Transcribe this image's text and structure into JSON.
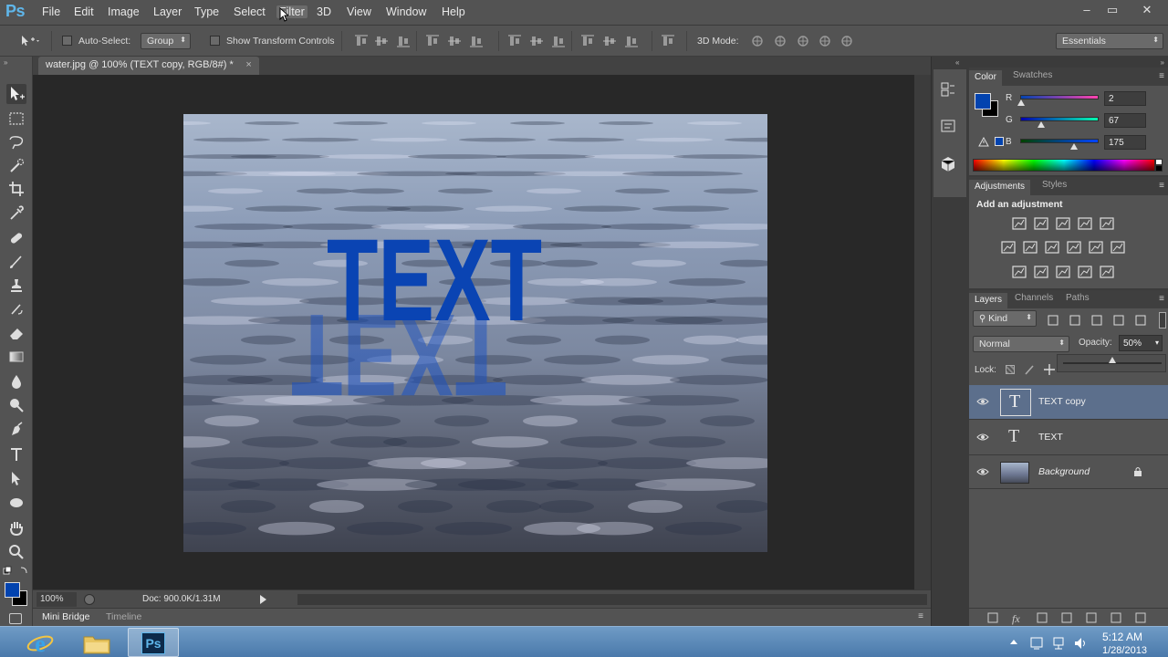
{
  "app": {
    "logo": "Ps",
    "menu": [
      "File",
      "Edit",
      "Image",
      "Layer",
      "Type",
      "Select",
      "Filter",
      "3D",
      "View",
      "Window",
      "Help"
    ],
    "window_controls": [
      "–",
      "▭",
      "✕"
    ]
  },
  "options_bar": {
    "auto_select_label": "Auto-Select:",
    "auto_select_target": "Group",
    "show_transform_label": "Show Transform Controls",
    "mode_3d_label": "3D Mode:",
    "workspace": "Essentials"
  },
  "document": {
    "tab_title": "water.jpg @ 100% (TEXT copy, RGB/8#) *",
    "tab_close": "×",
    "canvas_text": "TEXT",
    "zoom": "100%",
    "doc_info": "Doc: 900.0K/1.31M"
  },
  "bottom_tabs": [
    "Mini Bridge",
    "Timeline"
  ],
  "color_panel": {
    "tabs": [
      "Color",
      "Swatches"
    ],
    "foreground_hex": "#0243AF",
    "r_label": "R",
    "g_label": "G",
    "b_label": "B",
    "r": "2",
    "g": "67",
    "b": "175",
    "r_fraction": 0.008,
    "g_fraction": 0.263,
    "b_fraction": 0.686
  },
  "adjustments_panel": {
    "tabs": [
      "Adjustments",
      "Styles"
    ],
    "heading": "Add an adjustment"
  },
  "layers_panel": {
    "tabs": [
      "Layers",
      "Channels",
      "Paths"
    ],
    "filter_kind": "Kind",
    "blend_mode": "Normal",
    "opacity_label": "Opacity:",
    "opacity": "50%",
    "lock_label": "Lock:",
    "layers": [
      {
        "name": "TEXT copy",
        "type": "text",
        "selected": true
      },
      {
        "name": "TEXT",
        "type": "text",
        "selected": false
      },
      {
        "name": "Background",
        "type": "image",
        "selected": false,
        "locked": true
      }
    ]
  },
  "taskbar": {
    "apps": [
      "internet-explorer-icon",
      "file-explorer-icon",
      "photoshop-icon"
    ],
    "ps_label": "Ps",
    "time": "5:12 AM",
    "date": "1/28/2013"
  },
  "colors": {
    "brand": "#5fb6ea",
    "text_blue": "#0a44b3",
    "panel_bg": "#535353",
    "dark_bg": "#282828"
  }
}
